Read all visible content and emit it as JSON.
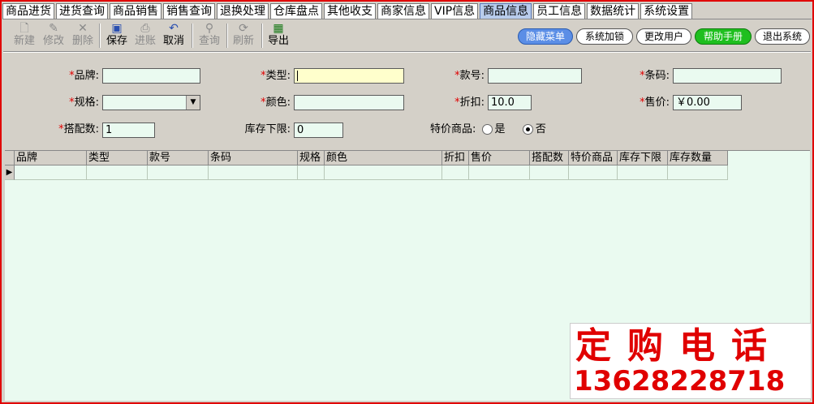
{
  "tabs": [
    "商品进货",
    "进货查询",
    "商品销售",
    "销售查询",
    "退换处理",
    "仓库盘点",
    "其他收支",
    "商家信息",
    "VIP信息",
    "商品信息",
    "员工信息",
    "数据统计",
    "系统设置"
  ],
  "active_tab": "商品信息",
  "toolbar": {
    "new": {
      "label": "新建",
      "icon": "new-doc-icon"
    },
    "edit": {
      "label": "修改",
      "icon": "edit-icon"
    },
    "delete": {
      "label": "删除",
      "icon": "delete-icon"
    },
    "save": {
      "label": "保存",
      "icon": "save-icon"
    },
    "void": {
      "label": "进账",
      "icon": "print-icon"
    },
    "cancel": {
      "label": "取消",
      "icon": "undo-icon"
    },
    "query": {
      "label": "查询",
      "icon": "binoculars-icon"
    },
    "refresh": {
      "label": "刷新",
      "icon": "refresh-icon"
    },
    "export": {
      "label": "导出",
      "icon": "excel-icon"
    }
  },
  "right_buttons": {
    "hide_menu": "隐藏菜单",
    "lock": "系统加锁",
    "change_user": "更改用户",
    "help": "帮助手册",
    "exit": "退出系统"
  },
  "form": {
    "required_mark": "*",
    "brand_label": "品牌:",
    "type_label": "类型:",
    "style_label": "款号:",
    "barcode_label": "条码:",
    "spec_label": "规格:",
    "color_label": "颜色:",
    "discount_label": "折扣:",
    "discount_value": "10.0",
    "price_label": "售价:",
    "price_value": "￥0.00",
    "match_qty_label": "搭配数:",
    "match_qty_value": "1",
    "stock_min_label": "库存下限:",
    "stock_min_value": "0",
    "special_label": "特价商品:",
    "special_yes": "是",
    "special_no": "否",
    "special_selected": "否"
  },
  "grid": {
    "columns": [
      "品牌",
      "类型",
      "款号",
      "条码",
      "规格",
      "颜色",
      "折扣",
      "售价",
      "搭配数",
      "特价商品",
      "库存下限",
      "库存数量"
    ],
    "row_marker": "▶"
  },
  "ad": {
    "title": "定购电话",
    "phone": "13628228718"
  },
  "colors": {
    "accent_red": "#e00000",
    "field_bg": "#eafaf0",
    "active_field_bg": "#ffffcc",
    "active_tab_bg": "#b8ccec"
  }
}
